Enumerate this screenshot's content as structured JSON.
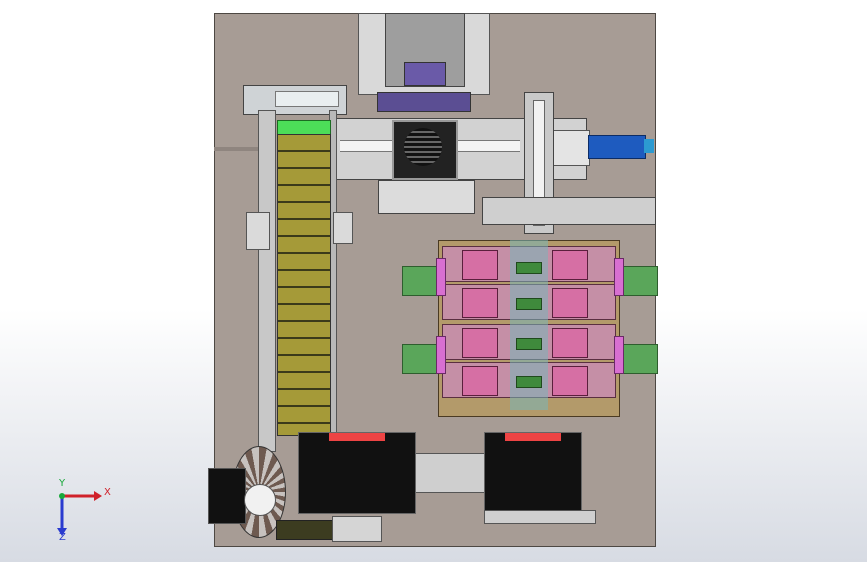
{
  "triad": {
    "x_label": "X",
    "y_label": "Y",
    "z_label": "Z",
    "x_color": "#d0212a",
    "y_color": "#18a83a",
    "z_color": "#2a3bcf"
  },
  "colors": {
    "background_top": "#ffffff",
    "background_bottom": "#d7dbe3",
    "base_plate": "#a79c95",
    "conveyor_belt": "#a59a38",
    "conveyor_head": "#4cdd58",
    "fixture_body": "#b39a6a",
    "fixture_clamp": "#d66fa4",
    "servo_motor": "#1e5bbf",
    "guide_rail": "#5aa65a",
    "motor_housing": "#111111"
  }
}
